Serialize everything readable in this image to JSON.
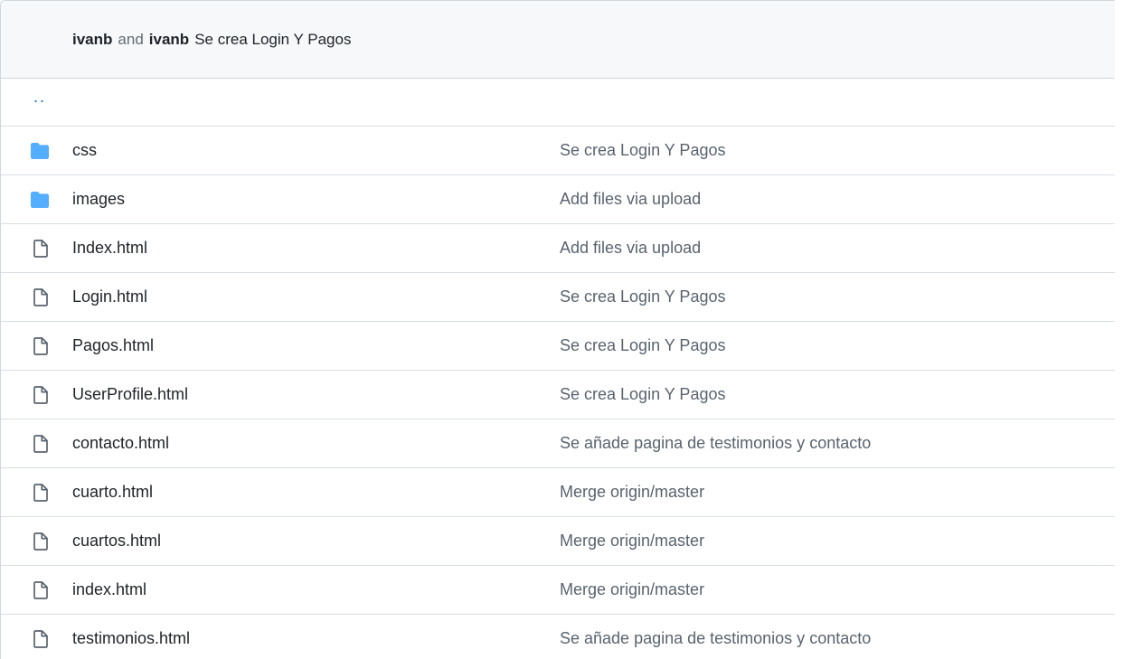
{
  "header": {
    "author1": "ivanb",
    "conjunction": "and",
    "author2": "ivanb",
    "message": "Se crea Login Y Pagos"
  },
  "parent_link": "..",
  "files": [
    {
      "type": "folder",
      "icon": "folder-icon",
      "name": "css",
      "message": "Se crea Login Y Pagos"
    },
    {
      "type": "folder",
      "icon": "folder-icon",
      "name": "images",
      "message": "Add files via upload"
    },
    {
      "type": "file",
      "icon": "file-icon",
      "name": "Index.html",
      "message": "Add files via upload"
    },
    {
      "type": "file",
      "icon": "file-icon",
      "name": "Login.html",
      "message": "Se crea Login Y Pagos"
    },
    {
      "type": "file",
      "icon": "file-icon",
      "name": "Pagos.html",
      "message": "Se crea Login Y Pagos"
    },
    {
      "type": "file",
      "icon": "file-icon",
      "name": "UserProfile.html",
      "message": "Se crea Login Y Pagos"
    },
    {
      "type": "file",
      "icon": "file-icon",
      "name": "contacto.html",
      "message": "Se añade pagina de testimonios y contacto"
    },
    {
      "type": "file",
      "icon": "file-icon",
      "name": "cuarto.html",
      "message": "Merge origin/master"
    },
    {
      "type": "file",
      "icon": "file-icon",
      "name": "cuartos.html",
      "message": "Merge origin/master"
    },
    {
      "type": "file",
      "icon": "file-icon",
      "name": "index.html",
      "message": "Merge origin/master"
    },
    {
      "type": "file",
      "icon": "file-icon",
      "name": "testimonios.html",
      "message": "Se añade pagina de testimonios y contacto"
    }
  ],
  "colors": {
    "folder": "#54aeff",
    "file_icon": "#59636e",
    "link": "#0969da",
    "header_bg": "#f6f8fa",
    "border": "#d0d7de"
  }
}
